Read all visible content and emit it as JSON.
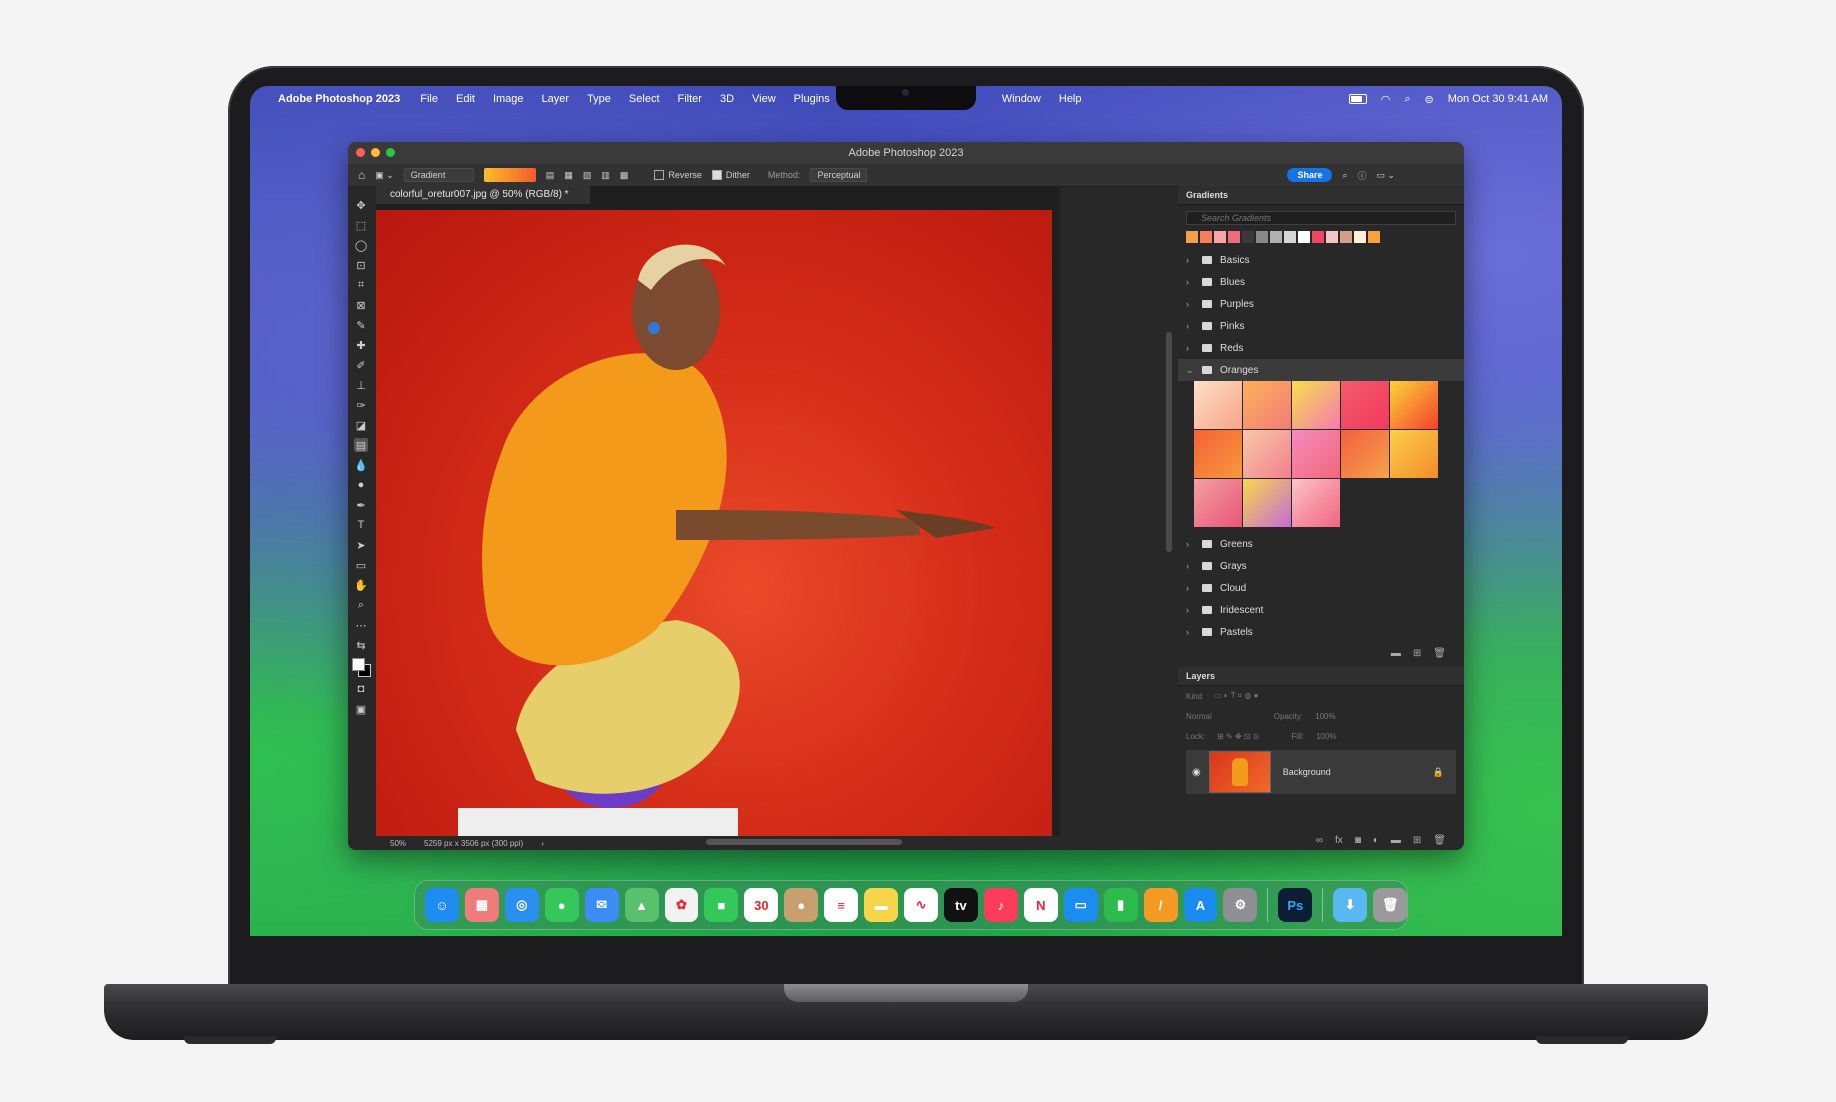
{
  "menubar": {
    "apple": "",
    "app_name": "Adobe Photoshop 2023",
    "items": [
      "File",
      "Edit",
      "Image",
      "Layer",
      "Type",
      "Select",
      "Filter",
      "3D",
      "View",
      "Plugins"
    ],
    "items_right": [
      "Window",
      "Help"
    ],
    "datetime": "Mon Oct 30  9:41 AM"
  },
  "window": {
    "title": "Adobe Photoshop 2023",
    "options": {
      "tool_preset": "Gradient",
      "reverse_label": "Reverse",
      "reverse_checked": false,
      "dither_label": "Dither",
      "dither_checked": true,
      "method_label": "Method:",
      "method_value": "Perceptual",
      "share_label": "Share",
      "gradient_colors": [
        "#fbbd2a",
        "#f35b2c"
      ]
    },
    "document": {
      "tab_label": "colorful_oretur007.jpg @ 50% (RGB/8) *",
      "zoom": "50%",
      "doc_info": "5259 px x 3506 px (300 ppi)"
    }
  },
  "gradients_panel": {
    "title": "Gradients",
    "search_placeholder": "Search Gradients",
    "recent_colors": [
      "#f5a04a",
      "#f47e5e",
      "#f7a4a4",
      "#ee6a7d",
      "#3a3a3a",
      "#8a8a8a",
      "#b0b0b0",
      "#d7d7d7",
      "#ffffff",
      "#f2465e",
      "#f5c5c5",
      "#d2a08a",
      "#fff0d8",
      "#f9a23c"
    ],
    "folders_before": [
      "Basics",
      "Blues",
      "Purples",
      "Pinks",
      "Reds"
    ],
    "open_folder": "Oranges",
    "oranges_swatches": [
      "linear-gradient(135deg,#fde0c8,#f8a38a)",
      "linear-gradient(135deg,#fbb25a,#f47a7a)",
      "linear-gradient(135deg,#f7e04a,#f47ab0)",
      "linear-gradient(135deg,#f55a6a,#f23a5e)",
      "linear-gradient(135deg,#fbd53a,#f4412c)",
      "linear-gradient(135deg,#f6603a,#f59a3a)",
      "linear-gradient(135deg,#f7c9a8,#f27f8e)",
      "linear-gradient(135deg,#f58cbf,#f2677a)",
      "linear-gradient(135deg,#f26040,#f7a24a)",
      "linear-gradient(135deg,#f9d14a,#f58a2a)",
      "linear-gradient(135deg,#f4a0a0,#e8557a)",
      "linear-gradient(135deg,#f9d84a,#c56ad8)",
      "linear-gradient(135deg,#fdc3c8,#f0657e)"
    ],
    "folders_after": [
      "Greens",
      "Grays",
      "Cloud",
      "Iridescent",
      "Pastels"
    ]
  },
  "layers_panel": {
    "title": "Layers",
    "filter_kind": "Kind",
    "blend_mode": "Normal",
    "opacity_label": "Opacity:",
    "opacity_value": "100%",
    "lock_label": "Lock:",
    "fill_label": "Fill:",
    "fill_value": "100%",
    "layer_name": "Background"
  },
  "dock": {
    "apps": [
      {
        "name": "Finder",
        "glyph": "☺",
        "color": "#1e8cf0"
      },
      {
        "name": "Launchpad",
        "glyph": "▦",
        "color": "#f07b7b"
      },
      {
        "name": "Safari",
        "glyph": "◎",
        "color": "#2a8ff0"
      },
      {
        "name": "Messages",
        "glyph": "●",
        "color": "#35c759"
      },
      {
        "name": "Mail",
        "glyph": "✉",
        "color": "#3b8df5"
      },
      {
        "name": "Maps",
        "glyph": "▲",
        "color": "#5ac06b"
      },
      {
        "name": "Photos",
        "glyph": "✿",
        "color": "#f2f2f2"
      },
      {
        "name": "FaceTime",
        "glyph": "■",
        "color": "#34c759"
      },
      {
        "name": "Calendar",
        "glyph": "30",
        "color": "#ffffff"
      },
      {
        "name": "Contacts",
        "glyph": "●",
        "color": "#c8a070"
      },
      {
        "name": "Reminders",
        "glyph": "≡",
        "color": "#ffffff"
      },
      {
        "name": "Notes",
        "glyph": "▬",
        "color": "#f7d54a"
      },
      {
        "name": "Freeform",
        "glyph": "∿",
        "color": "#ffffff"
      },
      {
        "name": "TV",
        "glyph": "tv",
        "color": "#111111"
      },
      {
        "name": "Music",
        "glyph": "♪",
        "color": "#fa3c5a"
      },
      {
        "name": "News",
        "glyph": "N",
        "color": "#ffffff"
      },
      {
        "name": "Keynote",
        "glyph": "▭",
        "color": "#1b8cf0"
      },
      {
        "name": "Numbers",
        "glyph": "▮",
        "color": "#2dbb4b"
      },
      {
        "name": "Pages",
        "glyph": "/",
        "color": "#f59a22"
      },
      {
        "name": "App Store",
        "glyph": "A",
        "color": "#1a8cf0"
      },
      {
        "name": "System Settings",
        "glyph": "⚙",
        "color": "#8e8e93"
      }
    ],
    "app_ps": {
      "name": "Photoshop",
      "glyph": "Ps",
      "color": "#0b1e33"
    },
    "folder": {
      "name": "Downloads",
      "glyph": "⬇",
      "color": "#5ab8f0"
    },
    "trash": {
      "name": "Trash",
      "glyph": "🗑",
      "color": "#9a9a9a"
    }
  }
}
